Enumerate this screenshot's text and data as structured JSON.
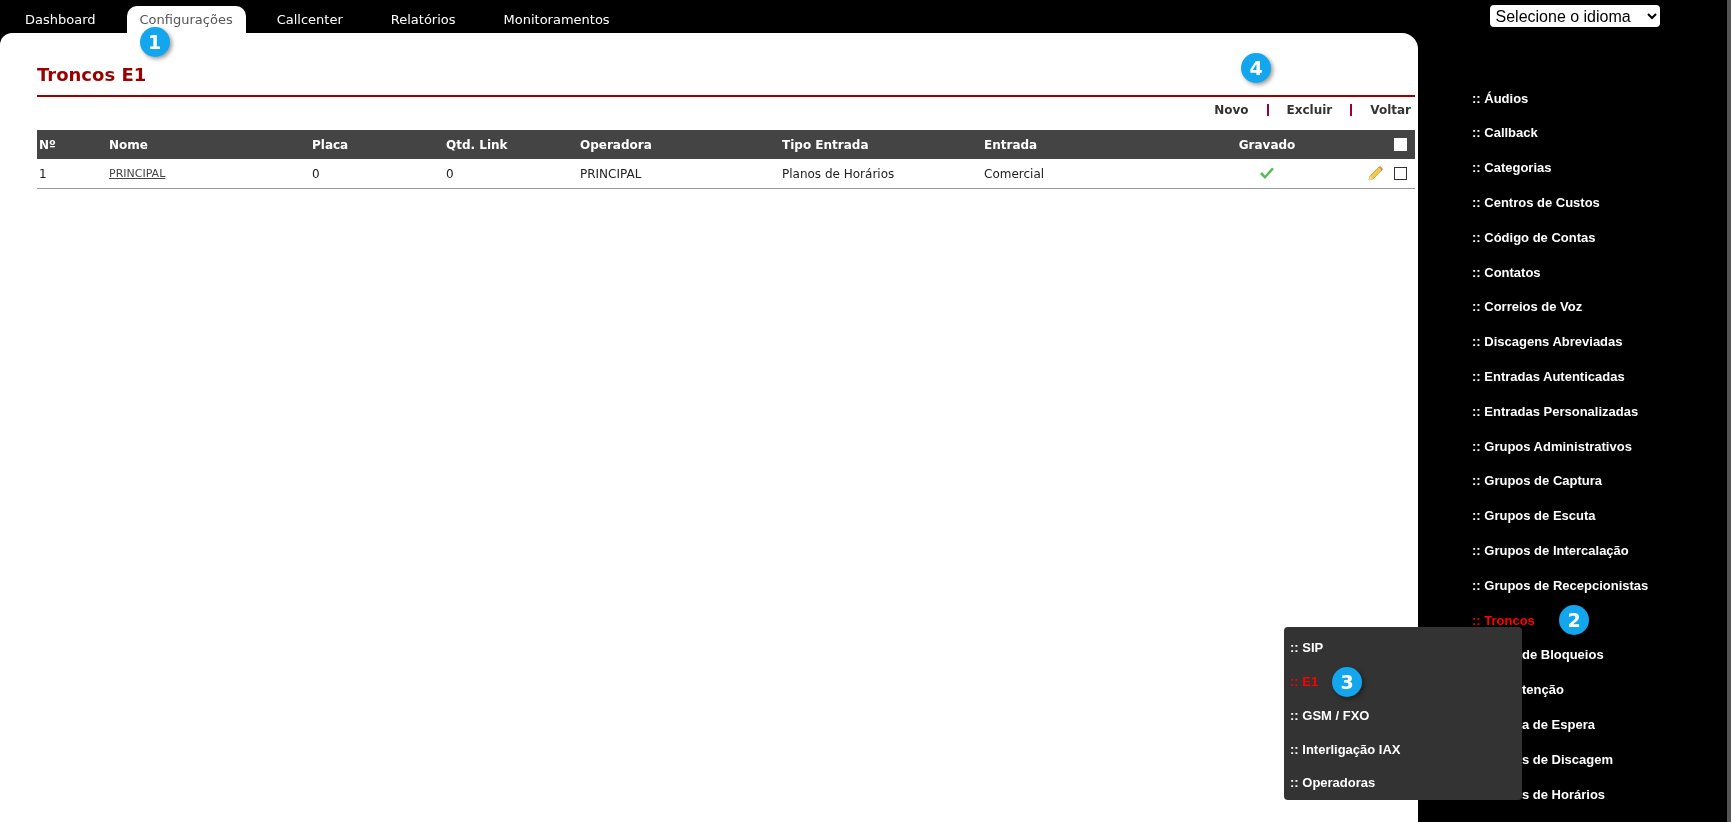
{
  "tabs": [
    {
      "label": "Dashboard",
      "selected": false
    },
    {
      "label": "Configurações",
      "selected": true,
      "callout": "1"
    },
    {
      "label": "Callcenter",
      "selected": false
    },
    {
      "label": "Relatórios",
      "selected": false
    },
    {
      "label": "Monitoramentos",
      "selected": false
    }
  ],
  "language_select": {
    "value": "Selecione o idioma"
  },
  "page": {
    "title": "Troncos E1",
    "actions": [
      "Novo",
      "Excluir",
      "Voltar"
    ],
    "actions_callout": "4"
  },
  "table": {
    "columns": [
      "Nº",
      "Nome",
      "Placa",
      "Qtd. Link",
      "Operadora",
      "Tipo Entrada",
      "Entrada",
      "Gravado"
    ],
    "select_all": false,
    "rows": [
      {
        "cells": [
          "1",
          "PRINCIPAL",
          "0",
          "0",
          "PRINCIPAL",
          "Planos de Horários",
          "Comercial"
        ],
        "saved": true,
        "checked": false
      }
    ]
  },
  "sidebar": {
    "items": [
      {
        "label": ":: Áudios",
        "selected": false,
        "covered": false
      },
      {
        "label": ":: Callback",
        "selected": false,
        "covered": false
      },
      {
        "label": ":: Categorias",
        "selected": false,
        "covered": false
      },
      {
        "label": ":: Centros de Custos",
        "selected": false,
        "covered": false
      },
      {
        "label": ":: Código de Contas",
        "selected": false,
        "covered": false
      },
      {
        "label": ":: Contatos",
        "selected": false,
        "covered": false
      },
      {
        "label": ":: Correios de Voz",
        "selected": false,
        "covered": false
      },
      {
        "label": ":: Discagens Abreviadas",
        "selected": false,
        "covered": false
      },
      {
        "label": ":: Entradas Autenticadas",
        "selected": false,
        "covered": false
      },
      {
        "label": ":: Entradas Personalizadas",
        "selected": false,
        "covered": false
      },
      {
        "label": ":: Grupos Administrativos",
        "selected": false,
        "covered": false
      },
      {
        "label": ":: Grupos de Captura",
        "selected": false,
        "covered": false
      },
      {
        "label": ":: Grupos de Escuta",
        "selected": false,
        "covered": false
      },
      {
        "label": ":: Grupos de Intercalação",
        "selected": false,
        "covered": false
      },
      {
        "label": ":: Grupos de Recepcionistas",
        "selected": false,
        "covered": false
      },
      {
        "label": ":: Troncos",
        "selected": true,
        "covered": false,
        "callout": "2"
      },
      {
        "label": "de Bloqueios",
        "selected": false,
        "covered": true
      },
      {
        "label": "tenção",
        "selected": false,
        "covered": true
      },
      {
        "label": "a de Espera",
        "selected": false,
        "covered": true
      },
      {
        "label": "s de Discagem",
        "selected": false,
        "covered": true
      },
      {
        "label": "s de Horários",
        "selected": false,
        "covered": true
      }
    ]
  },
  "submenu": {
    "items": [
      {
        "label": ":: SIP",
        "selected": false
      },
      {
        "label": ":: E1",
        "selected": true,
        "callout": "3"
      },
      {
        "label": ":: GSM / FXO",
        "selected": false
      },
      {
        "label": ":: Interligação IAX",
        "selected": false
      },
      {
        "label": ":: Operadoras",
        "selected": false
      }
    ]
  }
}
